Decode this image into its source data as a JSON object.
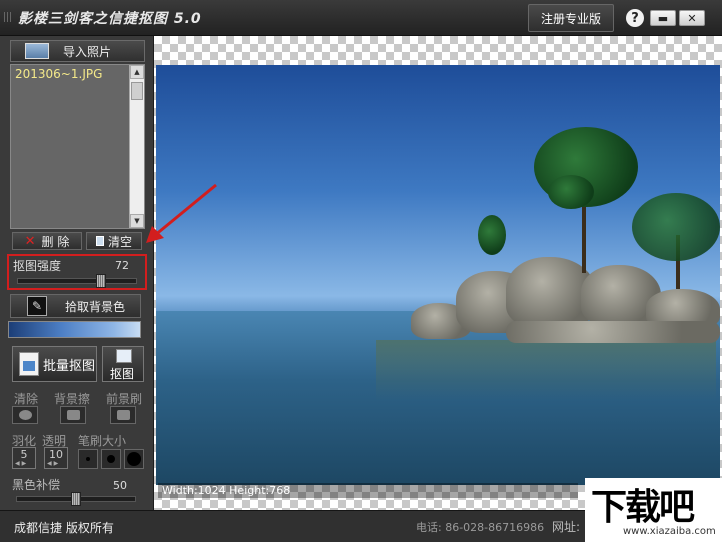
{
  "window": {
    "title": "影楼三剑客之信捷抠图 5.0",
    "register_label": "注册专业版",
    "help_label": "?",
    "min_label": "▬",
    "close_label": "✕"
  },
  "left_panel": {
    "import_label": "导入照片",
    "files": [
      "201306~1.JPG"
    ],
    "delete_label": "删 除",
    "clear_label": "清空",
    "strength_label": "抠图强度",
    "strength_value": "72",
    "strength_fraction": 0.72,
    "pick_bg_label": "拾取背景色",
    "batch_label": "批量抠图",
    "cut_label": "抠图",
    "tools": {
      "clear_label": "清除",
      "bg_brush_label": "背景擦",
      "fg_brush_label": "前景刷"
    },
    "feather_label": "羽化",
    "feather_value": "5",
    "transparent_label": "透明",
    "transparent_value": "10",
    "brush_size_label": "笔刷大小",
    "black_comp_label": "黑色补偿",
    "black_comp_value": "50",
    "black_comp_fraction": 0.5
  },
  "canvas": {
    "dims_text": "Width:1024  Height:768"
  },
  "status": {
    "copyright": "成都信捷  版权所有",
    "phone": "电话: 86-028-86716986",
    "website_label": "网址:"
  },
  "watermark": {
    "main": "下载吧",
    "sub": "www.xiazaiba.com"
  },
  "colors": {
    "highlight_border": "#d21e1e",
    "file_text": "#f4e98a"
  }
}
